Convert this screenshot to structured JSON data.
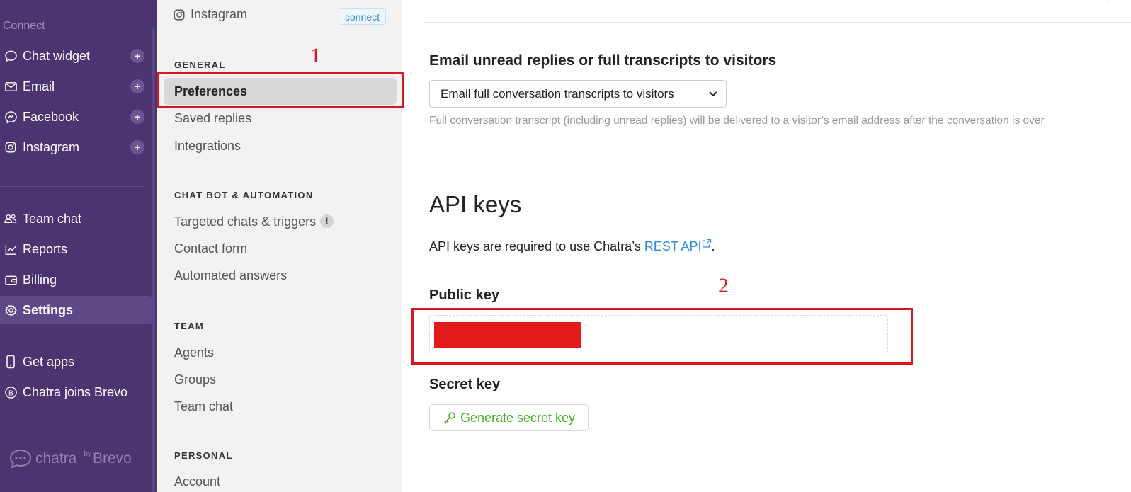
{
  "sidebar": {
    "section_label": "Connect",
    "connect_items": [
      {
        "label": "Chat widget",
        "icon": "chat-bubble-icon"
      },
      {
        "label": "Email",
        "icon": "envelope-icon"
      },
      {
        "label": "Facebook",
        "icon": "messenger-icon"
      },
      {
        "label": "Instagram",
        "icon": "instagram-icon"
      }
    ],
    "plus_label": "+",
    "main_items": [
      {
        "label": "Team chat",
        "icon": "team-icon"
      },
      {
        "label": "Reports",
        "icon": "chart-icon"
      },
      {
        "label": "Billing",
        "icon": "wallet-icon"
      },
      {
        "label": "Settings",
        "icon": "gear-icon",
        "active": true
      }
    ],
    "extra_items": [
      {
        "label": "Get apps",
        "icon": "phone-icon"
      },
      {
        "label": "Chatra joins Brevo",
        "icon": "brevo-b-icon"
      }
    ],
    "brand": {
      "name": "chatra",
      "by": "by",
      "partner": "Brevo"
    }
  },
  "subnav": {
    "instagram": {
      "label": "Instagram",
      "connect": "connect"
    },
    "general": {
      "heading": "GENERAL",
      "items": [
        "Preferences",
        "Saved replies",
        "Integrations"
      ]
    },
    "chatbot": {
      "heading": "CHAT BOT & AUTOMATION",
      "items": [
        "Targeted chats & triggers",
        "Contact form",
        "Automated answers"
      ],
      "badge": "!"
    },
    "team": {
      "heading": "TEAM",
      "items": [
        "Agents",
        "Groups",
        "Team chat"
      ]
    },
    "personal": {
      "heading": "PERSONAL",
      "items": [
        "Account"
      ]
    }
  },
  "main": {
    "email_heading": "Email unread replies or full transcripts to visitors",
    "email_select_value": "Email full conversation transcripts to visitors",
    "email_hint": "Full conversation transcript (including unread replies) will be delivered to a visitor’s email address after the conversation is over",
    "api_heading": "API keys",
    "api_desc_prefix": "API keys are required to use Chatra’s ",
    "api_desc_link": "REST API",
    "api_desc_suffix": ".",
    "public_key_label": "Public key",
    "secret_key_label": "Secret key",
    "generate_button": "Generate secret key"
  },
  "annotations": {
    "first": "1",
    "second": "2"
  },
  "colors": {
    "sidebar_bg": "#4b3470",
    "annotation_red": "#d7191f",
    "link_blue": "#2d8ae6",
    "button_green": "#43b02a"
  }
}
